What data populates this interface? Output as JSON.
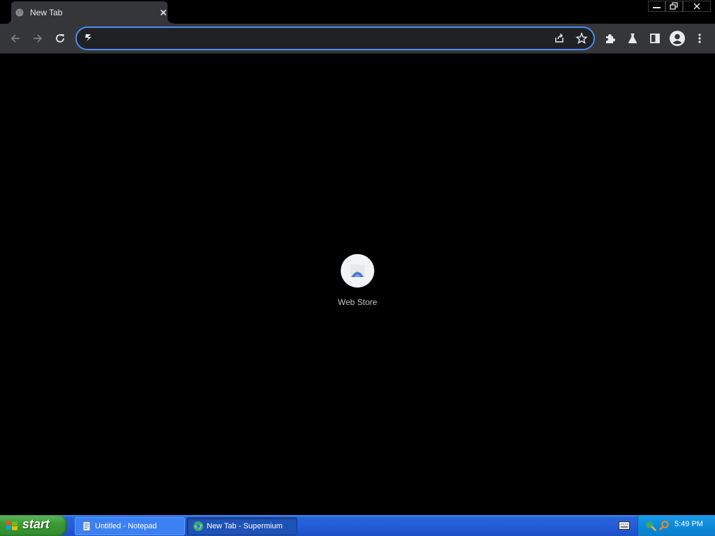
{
  "browser": {
    "tab": {
      "title": "New Tab",
      "favicon": "globe-icon",
      "close": "close-icon"
    },
    "window_controls": [
      "minimize-icon",
      "restore-icon",
      "close-icon"
    ],
    "toolbar": {
      "nav": [
        "back-arrow-icon",
        "forward-arrow-icon",
        "reload-icon"
      ],
      "omnibox": {
        "value": "",
        "placeholder": "",
        "left_icon": "site-info-icon",
        "right_icons": [
          "share-icon",
          "bookmark-star-icon"
        ]
      },
      "actions": [
        "extensions-puzzle-icon",
        "labs-flask-icon",
        "side-panel-icon",
        "profile-avatar-icon",
        "menu-kebab-icon"
      ]
    },
    "accent_color": "#4c8bf5",
    "content": {
      "shortcuts": [
        {
          "label": "Web Store",
          "icon": "web-store-icon"
        }
      ]
    }
  },
  "taskbar": {
    "start_label": "start",
    "tasks": [
      {
        "label": "Untitled - Notepad",
        "icon": "notepad-icon",
        "active": false
      },
      {
        "label": "New Tab - Supermium",
        "icon": "browser-icon",
        "active": true
      }
    ],
    "tray_icons": [
      "network-icon",
      "search-tray-icon"
    ],
    "clock": "5:49 PM"
  }
}
